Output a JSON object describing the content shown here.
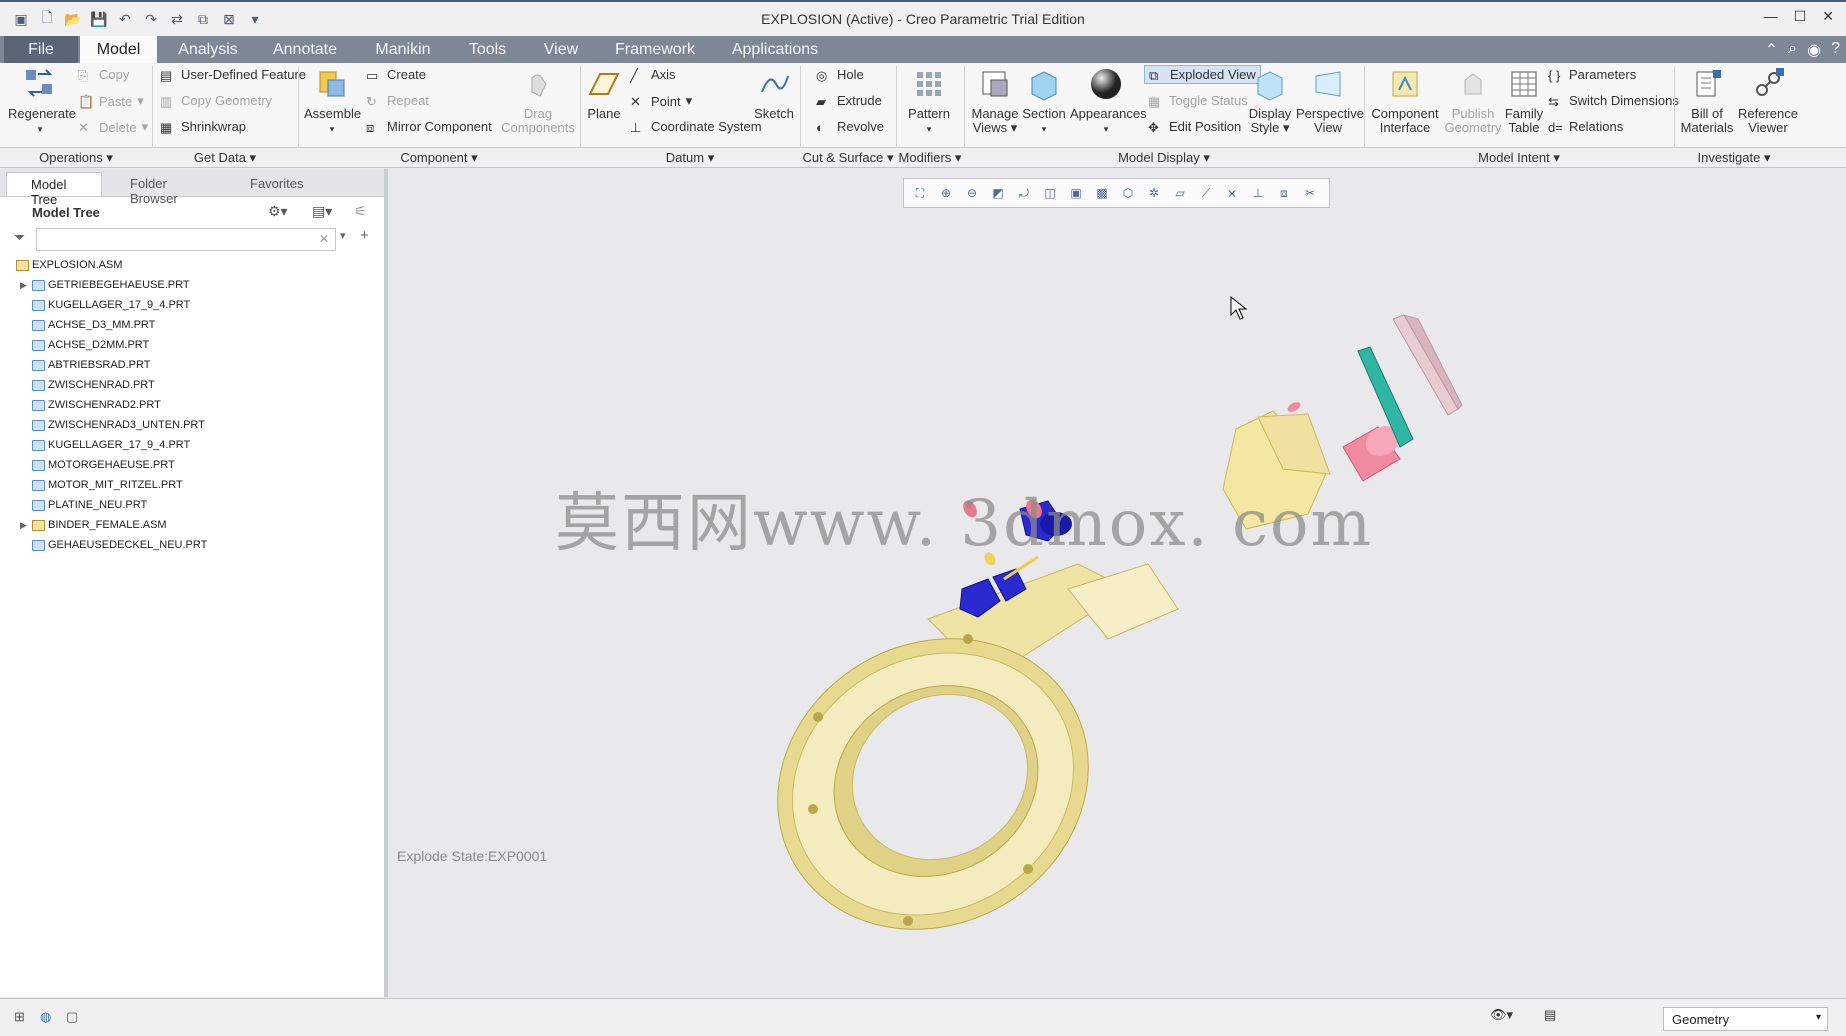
{
  "window": {
    "title": "EXPLOSION (Active) - Creo Parametric Trial Edition"
  },
  "tabs": [
    {
      "label": "File"
    },
    {
      "label": "Model"
    },
    {
      "label": "Analysis"
    },
    {
      "label": "Annotate"
    },
    {
      "label": "Manikin"
    },
    {
      "label": "Tools"
    },
    {
      "label": "View"
    },
    {
      "label": "Framework"
    },
    {
      "label": "Applications"
    }
  ],
  "ribbon": {
    "operations": {
      "regenerate": "Regenerate",
      "copy": "Copy",
      "paste": "Paste",
      "delete": "Delete",
      "label": "Operations"
    },
    "getdata": {
      "udf": "User-Defined Feature",
      "copy_geometry": "Copy Geometry",
      "shrinkwrap": "Shrinkwrap",
      "label": "Get Data"
    },
    "component": {
      "assemble": "Assemble",
      "create": "Create",
      "repeat": "Repeat",
      "mirror": "Mirror Component",
      "drag": "Drag Components",
      "label": "Component"
    },
    "datum": {
      "plane": "Plane",
      "axis": "Axis",
      "point": "Point",
      "csys": "Coordinate System",
      "sketch": "Sketch",
      "label": "Datum"
    },
    "cut": {
      "hole": "Hole",
      "extrude": "Extrude",
      "revolve": "Revolve",
      "label": "Cut & Surface"
    },
    "modifiers": {
      "pattern": "Pattern",
      "label": "Modifiers"
    },
    "display": {
      "manage_views": "Manage Views",
      "section": "Section",
      "appearances": "Appearances",
      "exploded_view": "Exploded View",
      "toggle_status": "Toggle Status",
      "edit_position": "Edit Position",
      "display_style": "Display Style",
      "perspective_view": "Perspective View",
      "label": "Model Display"
    },
    "intent": {
      "component_interface": "Component Interface",
      "publish_geometry": "Publish Geometry",
      "family_table": "Family Table",
      "parameters": "Parameters",
      "switch_dimensions": "Switch Dimensions",
      "relations": "Relations",
      "label": "Model Intent"
    },
    "investigate": {
      "bom": "Bill of Materials",
      "reference_viewer": "Reference Viewer",
      "label": "Investigate"
    }
  },
  "panel": {
    "tabs": [
      "Model Tree",
      "Folder Browser",
      "Favorites"
    ],
    "title": "Model Tree",
    "items": [
      {
        "name": "EXPLOSION.ASM",
        "type": "asm",
        "level": 0,
        "expander": ""
      },
      {
        "name": "GETRIEBEGEHAEUSE.PRT",
        "type": "prt",
        "level": 1,
        "expander": "▶"
      },
      {
        "name": "KUGELLAGER_17_9_4.PRT",
        "type": "prt",
        "level": 1,
        "expander": ""
      },
      {
        "name": "ACHSE_D3_MM.PRT",
        "type": "prt",
        "level": 1,
        "expander": ""
      },
      {
        "name": "ACHSE_D2MM.PRT",
        "type": "prt",
        "level": 1,
        "expander": ""
      },
      {
        "name": "ABTRIEBSRAD.PRT",
        "type": "prt",
        "level": 1,
        "expander": ""
      },
      {
        "name": "ZWISCHENRAD.PRT",
        "type": "prt",
        "level": 1,
        "expander": ""
      },
      {
        "name": "ZWISCHENRAD2.PRT",
        "type": "prt",
        "level": 1,
        "expander": ""
      },
      {
        "name": "ZWISCHENRAD3_UNTEN.PRT",
        "type": "prt",
        "level": 1,
        "expander": ""
      },
      {
        "name": "KUGELLAGER_17_9_4.PRT",
        "type": "prt",
        "level": 1,
        "expander": ""
      },
      {
        "name": "MOTORGEHAEUSE.PRT",
        "type": "prt",
        "level": 1,
        "expander": ""
      },
      {
        "name": "MOTOR_MIT_RITZEL.PRT",
        "type": "prt",
        "level": 1,
        "expander": ""
      },
      {
        "name": "PLATINE_NEU.PRT",
        "type": "prt",
        "level": 1,
        "expander": ""
      },
      {
        "name": "BINDER_FEMALE.ASM",
        "type": "asm",
        "level": 1,
        "expander": "▶"
      },
      {
        "name": "GEHAEUSEDECKEL_NEU.PRT",
        "type": "prt",
        "level": 1,
        "expander": ""
      }
    ]
  },
  "canvas": {
    "explode_state": "Explode State:EXP0001",
    "watermark": "莫西网www. 3dmox. com"
  },
  "status": {
    "filter": "Geometry"
  }
}
